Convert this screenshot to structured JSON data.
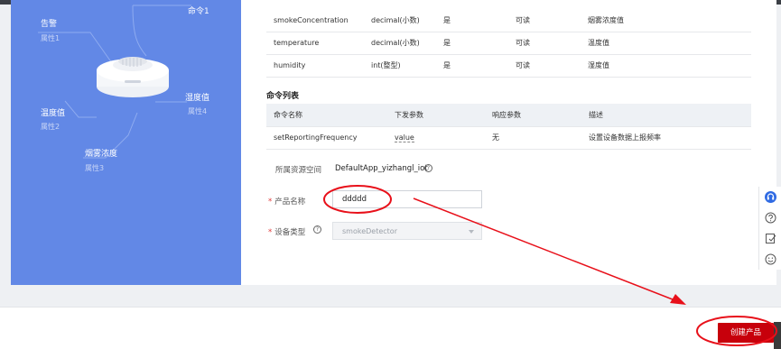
{
  "model_panel": {
    "nodes": [
      {
        "name": "命令1",
        "sub": ""
      },
      {
        "name": "告警",
        "sub": "属性1"
      },
      {
        "name": "湿度值",
        "sub": "属性4"
      },
      {
        "name": "温度值",
        "sub": "属性2"
      },
      {
        "name": "烟雾浓度",
        "sub": "属性3"
      }
    ]
  },
  "properties": [
    {
      "name": "smokeConcentration",
      "type": "decimal(小数)",
      "required": "是",
      "access": "可读",
      "desc": "烟雾浓度值"
    },
    {
      "name": "temperature",
      "type": "decimal(小数)",
      "required": "是",
      "access": "可读",
      "desc": "温度值"
    },
    {
      "name": "humidity",
      "type": "int(整型)",
      "required": "是",
      "access": "可读",
      "desc": "湿度值"
    }
  ],
  "commands": {
    "title": "命令列表",
    "headers": [
      "命令名称",
      "下发参数",
      "响应参数",
      "描述"
    ],
    "rows": [
      {
        "name": "setReportingFrequency",
        "param": "value",
        "response": "无",
        "desc": "设置设备数据上报频率"
      }
    ]
  },
  "form": {
    "resource_space_label": "所属资源空间",
    "resource_space_value": "DefaultApp_yizhangl_iot",
    "product_name_label": "产品名称",
    "product_name_value": "ddddd",
    "device_type_label": "设备类型",
    "device_type_value": "smokeDetector",
    "help_glyph": "?"
  },
  "footer": {
    "create_button": "创建产品"
  },
  "colors": {
    "panel_blue": "#6288e6",
    "brand_red": "#c7000b",
    "annotation_red": "#e8101a"
  },
  "side_tools": [
    "headset-icon",
    "help-icon",
    "feedback-icon",
    "smile-icon"
  ]
}
